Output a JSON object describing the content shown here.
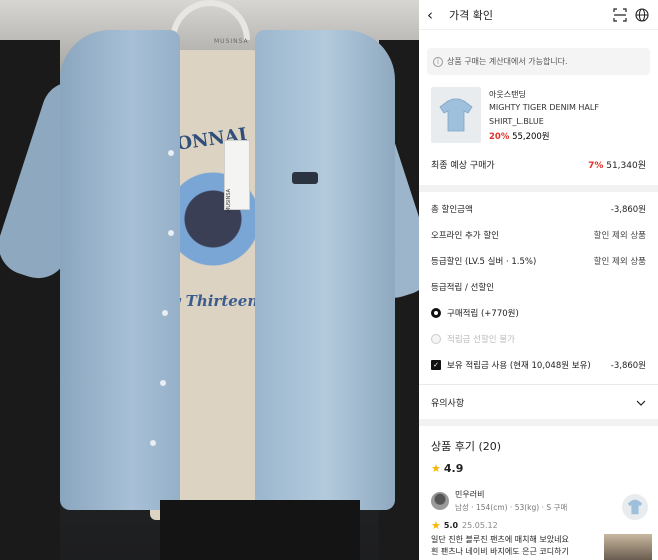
{
  "photo": {
    "hanger_brand": "MUSINSA",
    "tag_brand": "MUSINSA",
    "print_title": "CONNAI",
    "print_subtitle": "ay Thirteen"
  },
  "app": {
    "header": {
      "title": "가격 확인",
      "back_icon": "chevron-left-icon",
      "scan_icon": "scan-icon",
      "globe_icon": "globe-icon"
    },
    "notice": {
      "icon": "info-icon",
      "text": "상품 구매는 계산대에서 가능합니다."
    },
    "product": {
      "brand": "아웃스탠딩",
      "name_line1": "MIGHTY TIGER DENIM HALF",
      "name_line2": "SHIRT_L.BLUE",
      "discount": "20%",
      "price": "55,200원"
    },
    "final_price": {
      "label": "최종 예상 구매가",
      "discount": "7%",
      "value": "51,340원"
    },
    "summary": {
      "total_discount_label": "총 할인금액",
      "total_discount_value": "-3,860원",
      "online_extra_label": "오프라인 추가 할인",
      "online_extra_value": "할인 제외 상품",
      "grade_discount_label": "등급할인 (LV.5 실버 · 1.5%)",
      "grade_discount_value": "할인 제외 상품",
      "points_label": "등급적립 / 선할인",
      "points_option1": "구매적립 (+770원)",
      "points_option2": "적립금 선할인 불가",
      "reserve_label": "보유 적립금 사용 (현재 10,048원 보유)",
      "reserve_value": "-3,860원"
    },
    "notes": {
      "label": "유의사항",
      "icon": "chevron-down-icon"
    },
    "reviews": {
      "title": "상품 후기 (20)",
      "rating": "4.9",
      "reviewer_name": "민우러비",
      "reviewer_meta": "남성 · 154(cm) · 53(kg) · S 구매",
      "score": "5.0",
      "date": "25.05.12",
      "body": "일단 진한 블루진 팬츠에 매치해 보았네요 흰 팬츠나 네이비 바지에도 은근 코디하기"
    },
    "colors": {
      "accent_red": "#e0332b",
      "star": "#f7b600"
    }
  }
}
